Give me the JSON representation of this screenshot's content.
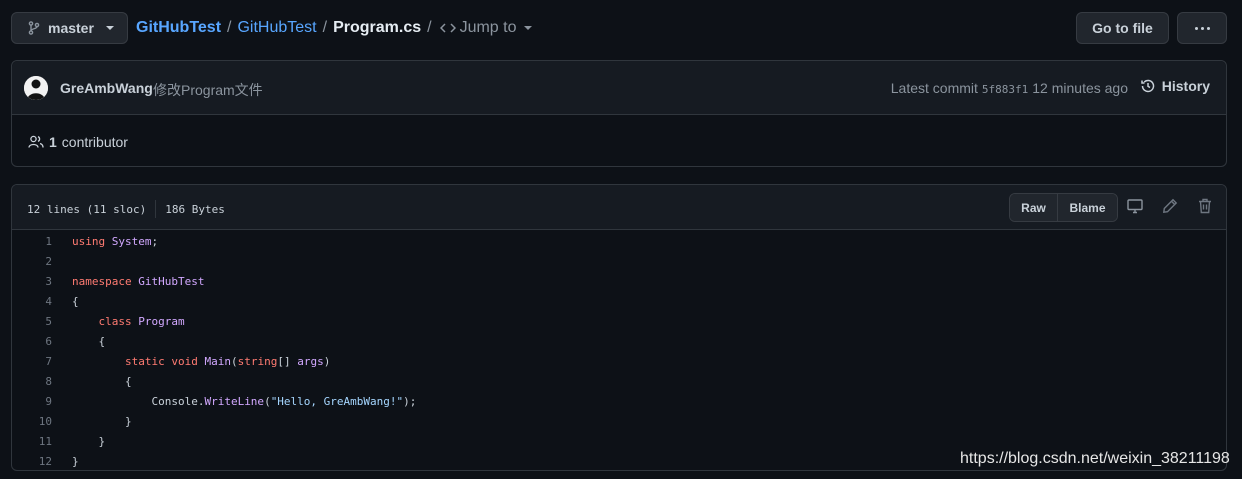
{
  "toolbar": {
    "branch": "master",
    "breadcrumb": {
      "owner": "GitHubTest",
      "repo": "GitHubTest",
      "file": "Program.cs"
    },
    "jump_to": "Jump to",
    "goto_file": "Go to file"
  },
  "commit": {
    "author": "GreAmbWang",
    "message": "修改Program文件",
    "latest_label": "Latest commit",
    "sha": "5f883f1",
    "time": "12 minutes ago",
    "history": "History"
  },
  "contributors": {
    "count": "1",
    "label": "contributor"
  },
  "file": {
    "lines_info": "12 lines (11 sloc)",
    "size": "186 Bytes",
    "raw": "Raw",
    "blame": "Blame"
  },
  "code": {
    "line_numbers": [
      "1",
      "2",
      "3",
      "4",
      "5",
      "6",
      "7",
      "8",
      "9",
      "10",
      "11",
      "12"
    ],
    "lines": [
      [
        {
          "t": "using",
          "c": "kw"
        },
        {
          "t": " "
        },
        {
          "t": "System",
          "c": "ty"
        },
        {
          "t": ";"
        }
      ],
      [],
      [
        {
          "t": "namespace",
          "c": "kw"
        },
        {
          "t": " "
        },
        {
          "t": "GitHubTest",
          "c": "ty"
        }
      ],
      [
        {
          "t": "{"
        }
      ],
      [
        {
          "t": "    "
        },
        {
          "t": "class",
          "c": "kw"
        },
        {
          "t": " "
        },
        {
          "t": "Program",
          "c": "ty"
        }
      ],
      [
        {
          "t": "    {"
        }
      ],
      [
        {
          "t": "        "
        },
        {
          "t": "static",
          "c": "kw"
        },
        {
          "t": " "
        },
        {
          "t": "void",
          "c": "kw"
        },
        {
          "t": " "
        },
        {
          "t": "Main",
          "c": "fn"
        },
        {
          "t": "("
        },
        {
          "t": "string",
          "c": "kw"
        },
        {
          "t": "[] "
        },
        {
          "t": "args",
          "c": "ty"
        },
        {
          "t": ")"
        }
      ],
      [
        {
          "t": "        {"
        }
      ],
      [
        {
          "t": "            Console."
        },
        {
          "t": "WriteLine",
          "c": "mt"
        },
        {
          "t": "("
        },
        {
          "t": "\"Hello, GreAmbWang!\"",
          "c": "str"
        },
        {
          "t": ");"
        }
      ],
      [
        {
          "t": "        }"
        }
      ],
      [
        {
          "t": "    }"
        }
      ],
      [
        {
          "t": "}"
        }
      ]
    ]
  },
  "watermark": "https://blog.csdn.net/weixin_38211198"
}
